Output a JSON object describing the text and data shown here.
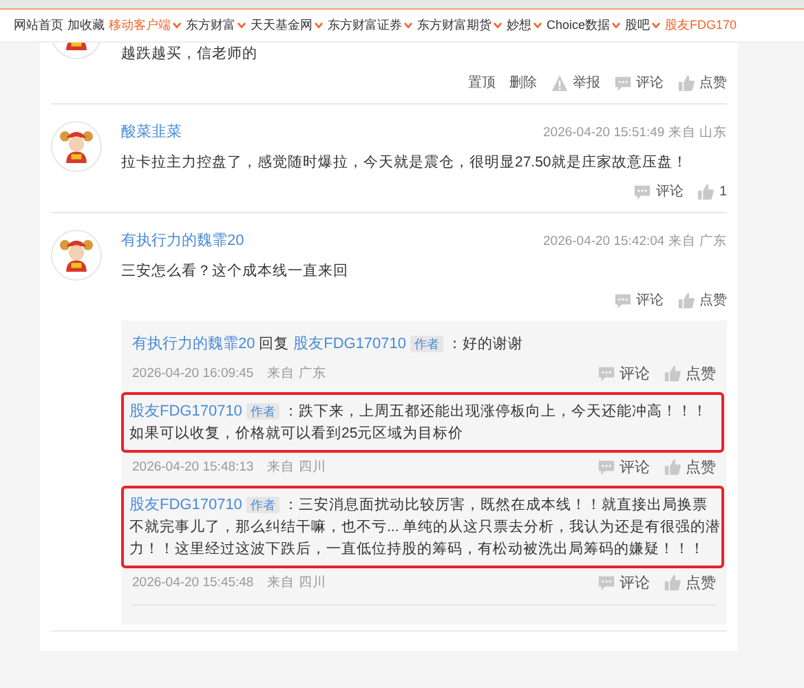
{
  "nav": [
    {
      "label": "网站首页",
      "dropdown": false,
      "highlight": false
    },
    {
      "label": "加收藏",
      "dropdown": false,
      "highlight": false
    },
    {
      "label": "移动客户端",
      "dropdown": true,
      "highlight": true
    },
    {
      "label": "东方财富",
      "dropdown": true,
      "highlight": false
    },
    {
      "label": "天天基金网",
      "dropdown": true,
      "highlight": false
    },
    {
      "label": "东方财富证券",
      "dropdown": true,
      "highlight": false
    },
    {
      "label": "东方财富期货",
      "dropdown": true,
      "highlight": false
    },
    {
      "label": "妙想",
      "dropdown": true,
      "highlight": false
    },
    {
      "label": "Choice数据",
      "dropdown": true,
      "highlight": false
    },
    {
      "label": "股吧",
      "dropdown": true,
      "highlight": false
    },
    {
      "label": "股友FDG170",
      "dropdown": false,
      "highlight": true
    }
  ],
  "comments": [
    {
      "partial": true,
      "text": "越跌越买，信老师的",
      "actions": [
        {
          "kind": "plain",
          "label": "置顶"
        },
        {
          "kind": "plain",
          "label": "删除"
        },
        {
          "kind": "report",
          "label": "举报"
        },
        {
          "kind": "comment",
          "label": "评论"
        },
        {
          "kind": "like",
          "label": "点赞"
        }
      ]
    },
    {
      "partial": false,
      "author": "酸菜韭菜",
      "time": "2026-04-20 15:51:49",
      "location": "来自 山东",
      "text": "拉卡拉主力控盘了，感觉随时爆拉，今天就是震仓，很明显27.50就是庄家故意压盘！",
      "actions": [
        {
          "kind": "comment",
          "label": "评论"
        },
        {
          "kind": "like",
          "label": "1"
        }
      ]
    },
    {
      "partial": false,
      "author": "有执行力的魏霏20",
      "time": "2026-04-20 15:42:04",
      "location": "来自 广东",
      "text": "三安怎么看？这个成本线一直来回",
      "actions": [
        {
          "kind": "comment",
          "label": "评论"
        },
        {
          "kind": "like",
          "label": "点赞"
        }
      ],
      "replies": [
        {
          "author": "有执行力的魏霏20",
          "reply_word": "回复",
          "reply_to": "股友FDG170710",
          "reply_to_badge": "作者",
          "text": "：好的谢谢",
          "time": "2026-04-20 16:09:45",
          "location": "来自 广东",
          "highlighted": false,
          "actions": [
            {
              "kind": "comment",
              "label": "评论"
            },
            {
              "kind": "like",
              "label": "点赞"
            }
          ]
        },
        {
          "author": "股友FDG170710",
          "author_badge": "作者",
          "text": "：跌下来，上周五都还能出现涨停板向上，今天还能冲高！！！如果可以收复，价格就可以看到25元区域为目标价",
          "time": "2026-04-20 15:48:13",
          "location": "来自 四川",
          "highlighted": true,
          "actions": [
            {
              "kind": "comment",
              "label": "评论"
            },
            {
              "kind": "like",
              "label": "点赞"
            }
          ]
        },
        {
          "author": "股友FDG170710",
          "author_badge": "作者",
          "text": "：三安消息面扰动比较厉害，既然在成本线！！就直接出局换票不就完事儿了，那么纠结干嘛，也不亏... 单纯的从这只票去分析，我认为还是有很强的潜力！！这里经过这波下跌后，一直低位持股的筹码，有松动被洗出局筹码的嫌疑！！！",
          "time": "2026-04-20 15:45:48",
          "location": "来自 四川",
          "highlighted": true,
          "actions": [
            {
              "kind": "comment",
              "label": "评论"
            },
            {
              "kind": "like",
              "label": "点赞"
            }
          ]
        }
      ]
    }
  ]
}
